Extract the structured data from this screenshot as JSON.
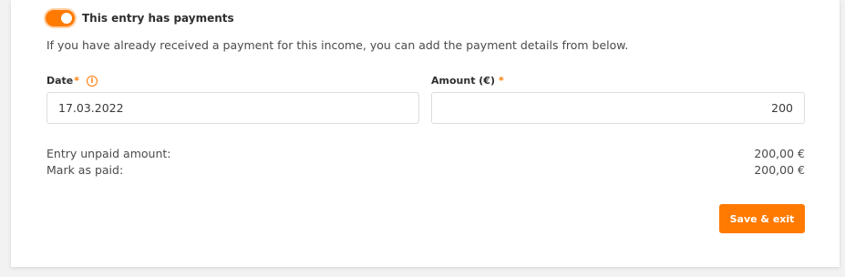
{
  "payments_toggle": {
    "label": "This entry has payments",
    "checked": true
  },
  "info_text": "If you have already received a payment for this income, you can add the payment details from below.",
  "date_field": {
    "label": "Date",
    "required_mark": "*",
    "info_icon": "i",
    "value": "17.03.2022"
  },
  "amount_field": {
    "label": "Amount (€)",
    "required_mark": "*",
    "value": "200"
  },
  "summary": {
    "unpaid_label": "Entry unpaid amount:",
    "unpaid_value": "200,00 €",
    "paid_label": "Mark as paid:",
    "paid_value": "200,00 €"
  },
  "save_button": "Save & exit",
  "colors": {
    "accent": "#ff7a00",
    "text": "#3a3a3a",
    "border": "#dddddd"
  }
}
